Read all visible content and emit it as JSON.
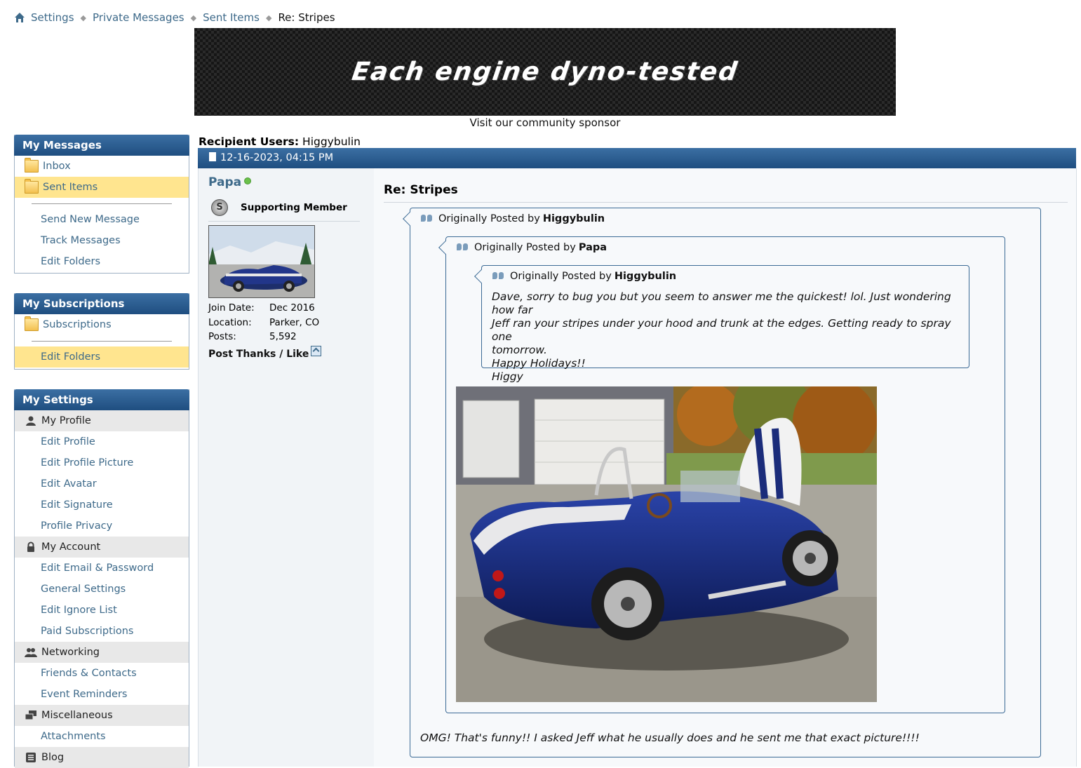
{
  "breadcrumb": {
    "items": [
      "Settings",
      "Private Messages",
      "Sent Items"
    ],
    "current": "Re: Stripes"
  },
  "banner": {
    "text": "Each engine dyno-tested",
    "caption": "Visit our community sponsor"
  },
  "sidebar": {
    "messages": {
      "title": "My Messages",
      "folders": [
        "Inbox",
        "Sent Items"
      ],
      "links": [
        "Send New Message",
        "Track Messages",
        "Edit Folders"
      ]
    },
    "subscriptions": {
      "title": "My Subscriptions",
      "folders": [
        "Subscriptions"
      ],
      "links": [
        "Edit Folders"
      ]
    },
    "settings": {
      "title": "My Settings",
      "profile_group": "My Profile",
      "profile_links": [
        "Edit Profile",
        "Edit Profile Picture",
        "Edit Avatar",
        "Edit Signature",
        "Profile Privacy"
      ],
      "account_group": "My Account",
      "account_links": [
        "Edit Email & Password",
        "General Settings",
        "Edit Ignore List",
        "Paid Subscriptions"
      ],
      "networking_group": "Networking",
      "networking_links": [
        "Friends & Contacts",
        "Event Reminders"
      ],
      "misc_group": "Miscellaneous",
      "misc_links": [
        "Attachments"
      ],
      "blog_group": "Blog"
    }
  },
  "message": {
    "recipients_label": "Recipient Users:",
    "recipients": "Higgybulin",
    "date": "12-16-2023, 04:15 PM",
    "title": "Re: Stripes",
    "reply": "OMG! That's funny!! I asked Jeff what he usually does and he sent me that exact picture!!!!"
  },
  "user": {
    "name": "Papa",
    "rank": "Supporting Member",
    "rank_badge": "S",
    "join_date_label": "Join Date:",
    "join_date": "Dec 2016",
    "location_label": "Location:",
    "location": "Parker, CO",
    "posts_label": "Posts:",
    "posts": "5,592",
    "thanks_label": "Post Thanks / Like"
  },
  "quotes": {
    "outer": {
      "prefix": "Originally Posted by",
      "author": "Higgybulin"
    },
    "middle": {
      "prefix": "Originally Posted by",
      "author": "Papa"
    },
    "inner": {
      "prefix": "Originally Posted by",
      "author": "Higgybulin",
      "lines": [
        "Dave, sorry to bug you but you seem to answer me the quickest! lol. Just wondering how far",
        "Jeff ran your stripes under your hood and trunk at the edges. Getting ready to spray one",
        "tomorrow.",
        "Happy Holidays!!",
        "Higgy"
      ]
    }
  },
  "colors": {
    "header_blue": "#1f4e80",
    "link": "#3e6a8a",
    "active_row": "#ffe58f",
    "quote_border": "#3b6a95"
  }
}
